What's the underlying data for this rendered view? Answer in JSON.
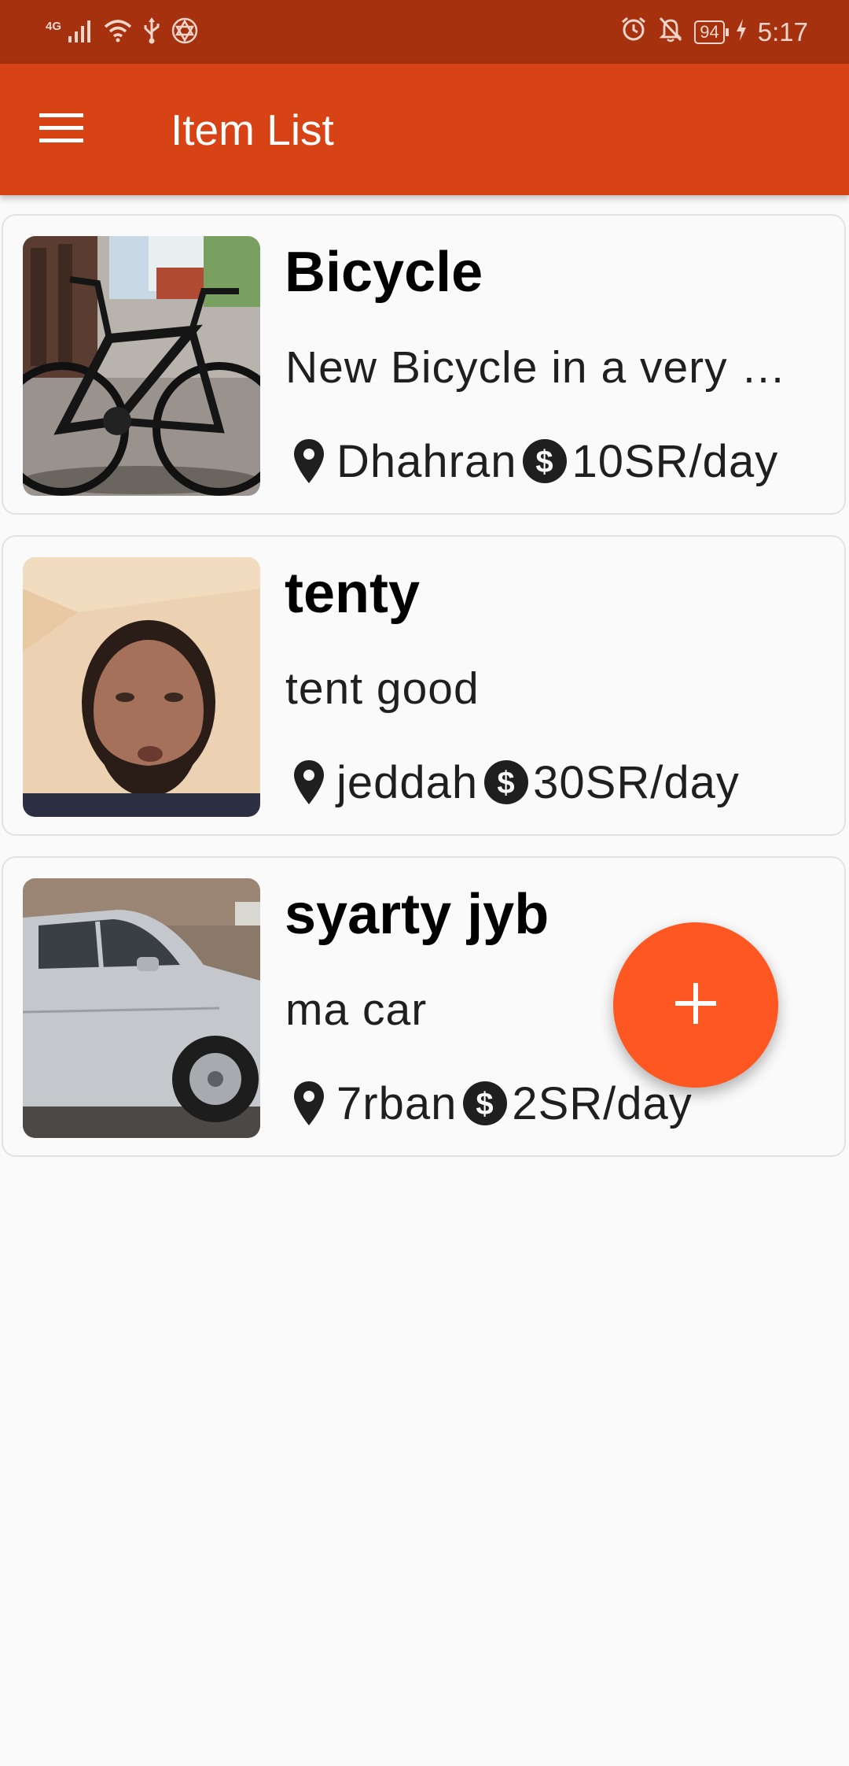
{
  "status_bar": {
    "network": "4G",
    "time": "5:17",
    "battery": "94"
  },
  "app_bar": {
    "title": "Item List"
  },
  "items": [
    {
      "title": "Bicycle",
      "description": "New Bicycle in a very good condition",
      "location": "Dhahran",
      "price": "10SR/day"
    },
    {
      "title": "tenty",
      "description": "tent good",
      "location": "jeddah",
      "price": "30SR/day"
    },
    {
      "title": "syarty jyb",
      "description": "ma car",
      "location": "7rban",
      "price": "2SR/day"
    }
  ],
  "colors": {
    "status_bar": "#a5310f",
    "app_bar": "#d84315",
    "fab": "#ff5722",
    "background": "#fafafa"
  },
  "icons": {
    "menu": "menu-icon",
    "location": "location-pin-icon",
    "price": "dollar-circle-icon",
    "add": "plus-icon"
  }
}
